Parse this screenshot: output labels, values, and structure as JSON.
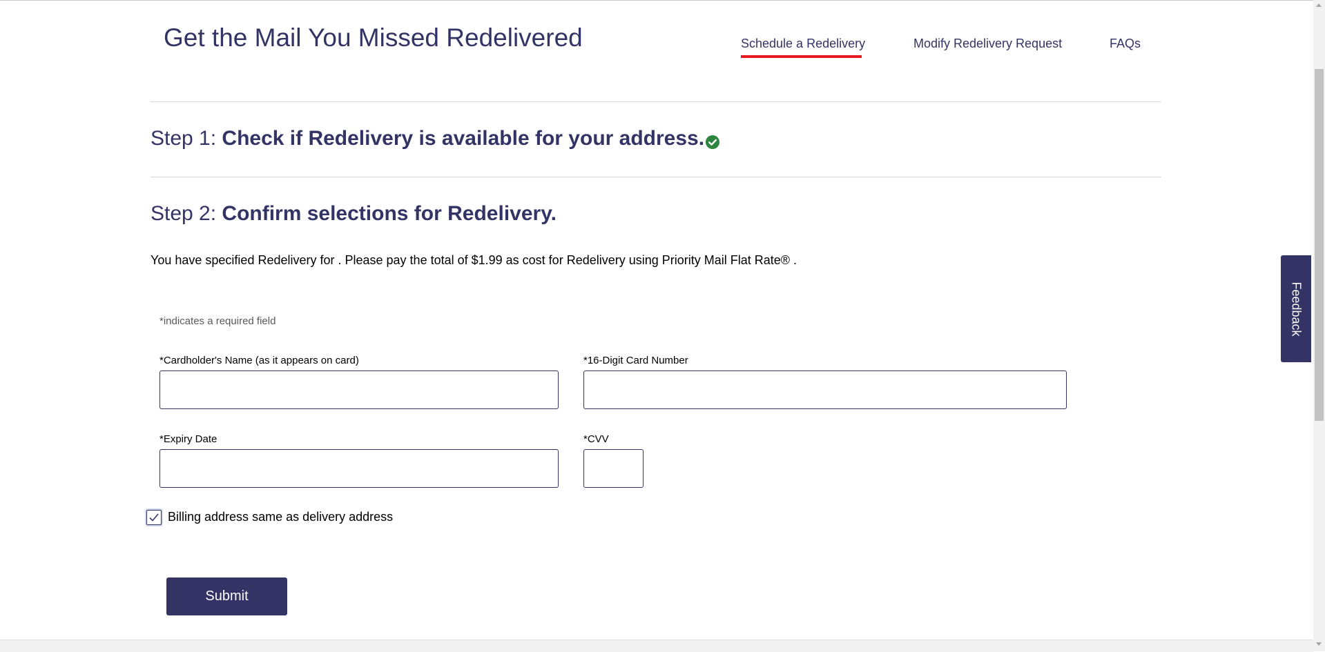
{
  "header": {
    "title": "Get the Mail You Missed Redelivered",
    "nav": [
      {
        "label": "Schedule a Redelivery",
        "active": true
      },
      {
        "label": "Modify Redelivery Request",
        "active": false
      },
      {
        "label": "FAQs",
        "active": false
      }
    ]
  },
  "steps": {
    "step1": {
      "prefix": "Step 1: ",
      "text": "Check if Redelivery is available for your address.",
      "status_icon": "check-circle-icon"
    },
    "step2": {
      "prefix": "Step 2: ",
      "text": "Confirm selections for Redelivery."
    }
  },
  "payment": {
    "info_text": "You have specified Redelivery for . Please pay the total of $1.99 as cost for Redelivery using Priority Mail Flat Rate® .",
    "required_note": "*indicates a required field",
    "fields": {
      "cardholder_name": {
        "label": "*Cardholder's Name (as it appears on card)",
        "value": ""
      },
      "card_number": {
        "label": "*16-Digit Card Number",
        "value": ""
      },
      "expiry_date": {
        "label": "*Expiry Date",
        "value": ""
      },
      "cvv": {
        "label": "*CVV",
        "value": ""
      }
    },
    "billing_same": {
      "label": "Billing address same as delivery address",
      "checked": true
    },
    "submit_label": "Submit"
  },
  "feedback": {
    "label": "Feedback"
  },
  "colors": {
    "brand_navy": "#333366",
    "accent_red": "#e71921",
    "success_green": "#2e8540"
  }
}
